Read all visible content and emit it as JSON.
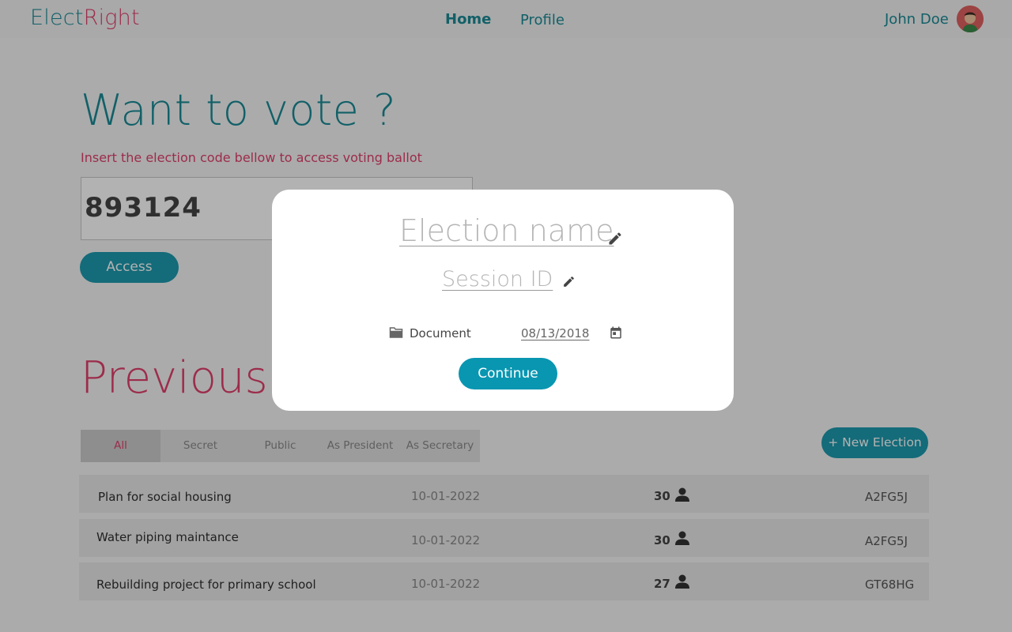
{
  "header": {
    "logo_part1": "Elect",
    "logo_part2": "Right",
    "nav_home": "Home",
    "nav_profile": "Profile",
    "user_name": "John Doe"
  },
  "hero": {
    "title": "Want to vote ?",
    "subtitle": "Insert the election code bellow to access voting ballot",
    "code_value": "893124",
    "access_label": "Access"
  },
  "previous": {
    "title": "Previous elections",
    "filters": [
      "All",
      "Secret",
      "Public",
      "As President",
      "As Secretary"
    ],
    "new_election_label": "+ New Election",
    "rows": [
      {
        "name": "Plan for social housing",
        "date": "10-01-2022",
        "count": "30",
        "code": "A2FG5J"
      },
      {
        "name": "Water piping maintance",
        "date": "10-01-2022",
        "count": "30",
        "code": "A2FG5J"
      },
      {
        "name": "Rebuilding project for primary school",
        "date": "10-01-2022",
        "count": "27",
        "code": "GT68HG"
      }
    ]
  },
  "modal": {
    "title_placeholder": "Election name",
    "session_placeholder": "Session ID",
    "document_label": "Document",
    "date_value": "08/13/2018",
    "continue_label": "Continue"
  },
  "colors": {
    "accent_teal": "#1a8a96",
    "accent_pink": "#e0406c",
    "button_teal": "#1d9aae"
  }
}
